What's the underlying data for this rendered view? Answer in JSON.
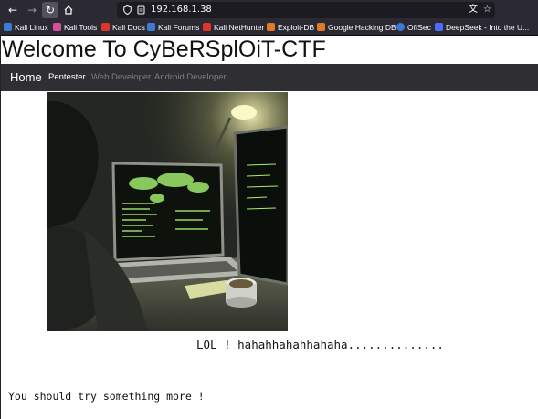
{
  "browser": {
    "url": "192.168.1.38",
    "bookmarks": [
      {
        "label": "Kali Linux",
        "color": "#3d7ad6"
      },
      {
        "label": "Kali Tools",
        "color": "#d64ea0"
      },
      {
        "label": "Kali Docs",
        "color": "#e0352b"
      },
      {
        "label": "Kali Forums",
        "color": "#3d7ad6"
      },
      {
        "label": "Kali NetHunter",
        "color": "#e0352b"
      },
      {
        "label": "Exploit-DB",
        "color": "#e07a2b"
      },
      {
        "label": "Google Hacking DB",
        "color": "#e07a2b"
      },
      {
        "label": "OffSec",
        "color": "#3d7ad6"
      },
      {
        "label": "DeepSeek - Into the U...",
        "color": "#4d6bfe"
      }
    ]
  },
  "site": {
    "title": "Welcome To CyBeRSplOiT-CTF",
    "nav": {
      "home": "Home",
      "pentester": "Pentester",
      "web_developer": "Web Developer",
      "android_developer": "Android Developer"
    },
    "lol_text": "LOL ! hahahhahahhahaha..............",
    "hint_text": "You should try something more !"
  },
  "colors": {
    "navbar": "#2f2f33",
    "nav_inactive": "#7d7d80",
    "browser_chrome": "#2b2a33"
  }
}
